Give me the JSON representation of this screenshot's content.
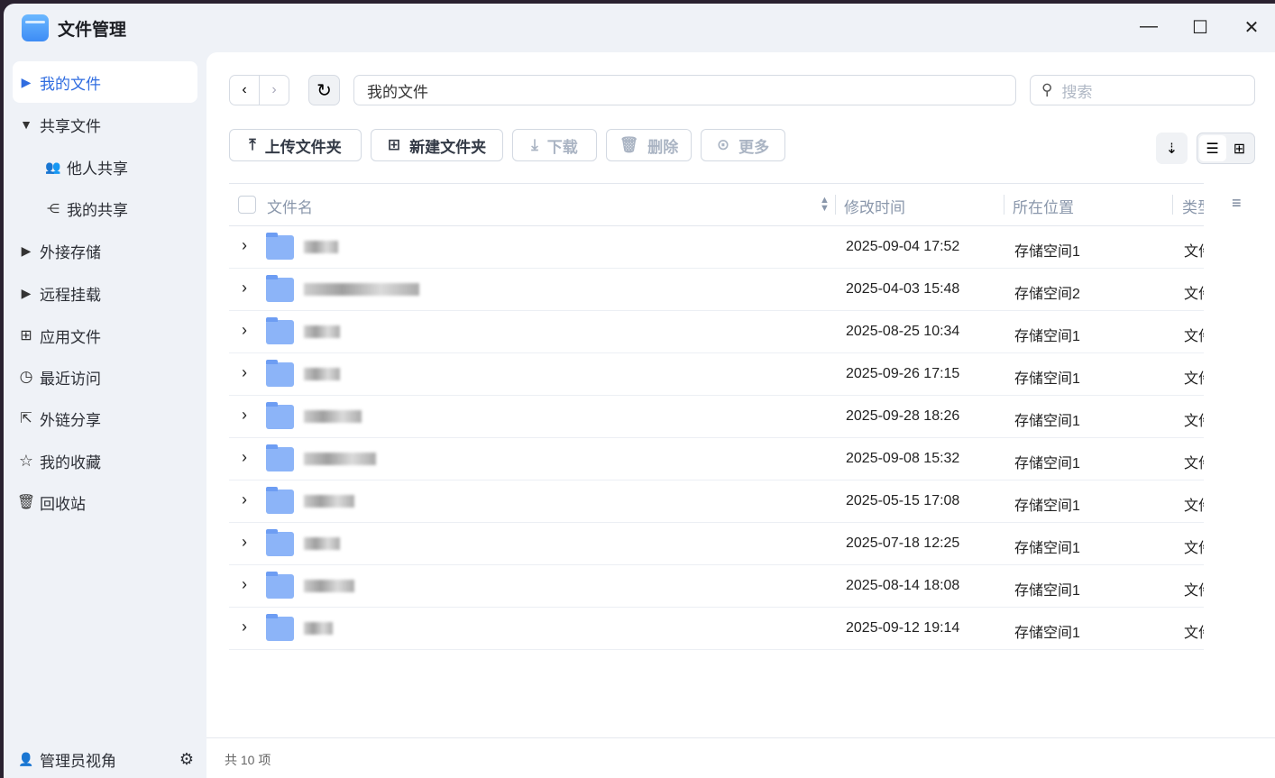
{
  "app": {
    "title": "文件管理"
  },
  "window": {
    "minimize": "—",
    "maximize": "☐",
    "close": "✕"
  },
  "sidebar": {
    "items": [
      {
        "label": "我的文件",
        "icon": "caret-right-icon"
      },
      {
        "label": "共享文件",
        "icon": "caret-down-icon"
      },
      {
        "label": "他人共享",
        "icon": "users-icon"
      },
      {
        "label": "我的共享",
        "icon": "share-icon"
      },
      {
        "label": "外接存储",
        "icon": "caret-right-icon"
      },
      {
        "label": "远程挂载",
        "icon": "caret-right-icon"
      },
      {
        "label": "应用文件",
        "icon": "apps-icon"
      },
      {
        "label": "最近访问",
        "icon": "clock-icon"
      },
      {
        "label": "外链分享",
        "icon": "link-share-icon"
      },
      {
        "label": "我的收藏",
        "icon": "star-icon"
      },
      {
        "label": "回收站",
        "icon": "trash-icon"
      }
    ],
    "admin_view": "管理员视角"
  },
  "path": "我的文件",
  "search": {
    "placeholder": "搜索"
  },
  "toolbar": {
    "upload": "上传文件夹",
    "new_folder": "新建文件夹",
    "download": "下载",
    "delete": "删除",
    "more": "更多"
  },
  "columns": {
    "name": "文件名",
    "modified": "修改时间",
    "location": "所在位置",
    "type": "类型"
  },
  "rows": [
    {
      "modified": "2025-09-04 17:52",
      "location": "存储空间1",
      "type": "文件夹"
    },
    {
      "modified": "2025-04-03 15:48",
      "location": "存储空间2",
      "type": "文件夹"
    },
    {
      "modified": "2025-08-25 10:34",
      "location": "存储空间1",
      "type": "文件夹"
    },
    {
      "modified": "2025-09-26 17:15",
      "location": "存储空间1",
      "type": "文件夹"
    },
    {
      "modified": "2025-09-28 18:26",
      "location": "存储空间1",
      "type": "文件夹"
    },
    {
      "modified": "2025-09-08 15:32",
      "location": "存储空间1",
      "type": "文件夹"
    },
    {
      "modified": "2025-05-15 17:08",
      "location": "存储空间1",
      "type": "文件夹"
    },
    {
      "modified": "2025-07-18 12:25",
      "location": "存储空间1",
      "type": "文件夹"
    },
    {
      "modified": "2025-08-14 18:08",
      "location": "存储空间1",
      "type": "文件夹"
    },
    {
      "modified": "2025-09-12 19:14",
      "location": "存储空间1",
      "type": "文件夹"
    }
  ],
  "footer": {
    "count": "共 10 项"
  }
}
